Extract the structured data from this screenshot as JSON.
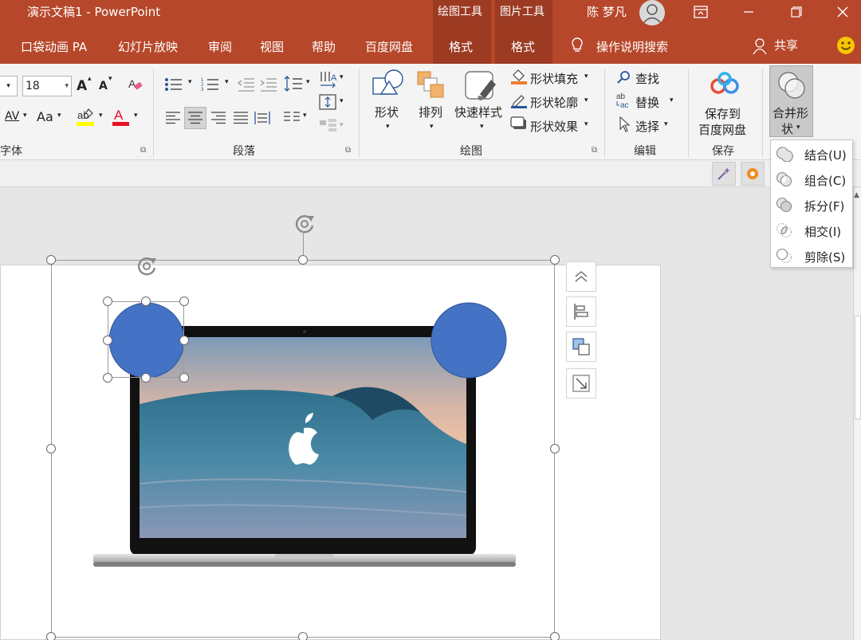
{
  "window": {
    "title": "演示文稿1  -  PowerPoint",
    "context_tabs": [
      "绘图工具",
      "图片工具"
    ],
    "user": "陈 梦凡",
    "controls": [
      "restore-ribbon",
      "minimize",
      "maximize",
      "close"
    ]
  },
  "menu": {
    "items": [
      "口袋动画 PA",
      "幻灯片放映",
      "审阅",
      "视图",
      "帮助",
      "百度网盘",
      "格式",
      "格式"
    ],
    "tell_me": "操作说明搜索",
    "share": "共享",
    "active_index": 6
  },
  "ribbon": {
    "font": {
      "size": "18",
      "grow": "A",
      "shrink": "A",
      "spacing": "AV",
      "case": "Aa",
      "label": "字体"
    },
    "paragraph": {
      "label": "段落"
    },
    "drawing": {
      "shapes": "形状",
      "arrange": "排列",
      "quick_styles": "快速样式",
      "fill": "形状填充",
      "outline": "形状轮廓",
      "effects": "形状效果",
      "label": "绘图"
    },
    "editing": {
      "find": "查找",
      "replace": "替换",
      "select": "选择",
      "label": "编辑"
    },
    "save": {
      "button_line1": "保存到",
      "button_line2": "百度网盘",
      "label": "保存"
    },
    "merge": {
      "line1": "合并形",
      "line2": "状"
    }
  },
  "merge_menu": {
    "items": [
      "结合(U)",
      "组合(C)",
      "拆分(F)",
      "相交(I)",
      "剪除(S)"
    ]
  },
  "colors": {
    "title_bar": "#b7472a",
    "context_tab": "#9c3a22",
    "circle_fill": "#4472c4",
    "highlight_yellow": "#ffff00",
    "font_red": "#e81123"
  }
}
